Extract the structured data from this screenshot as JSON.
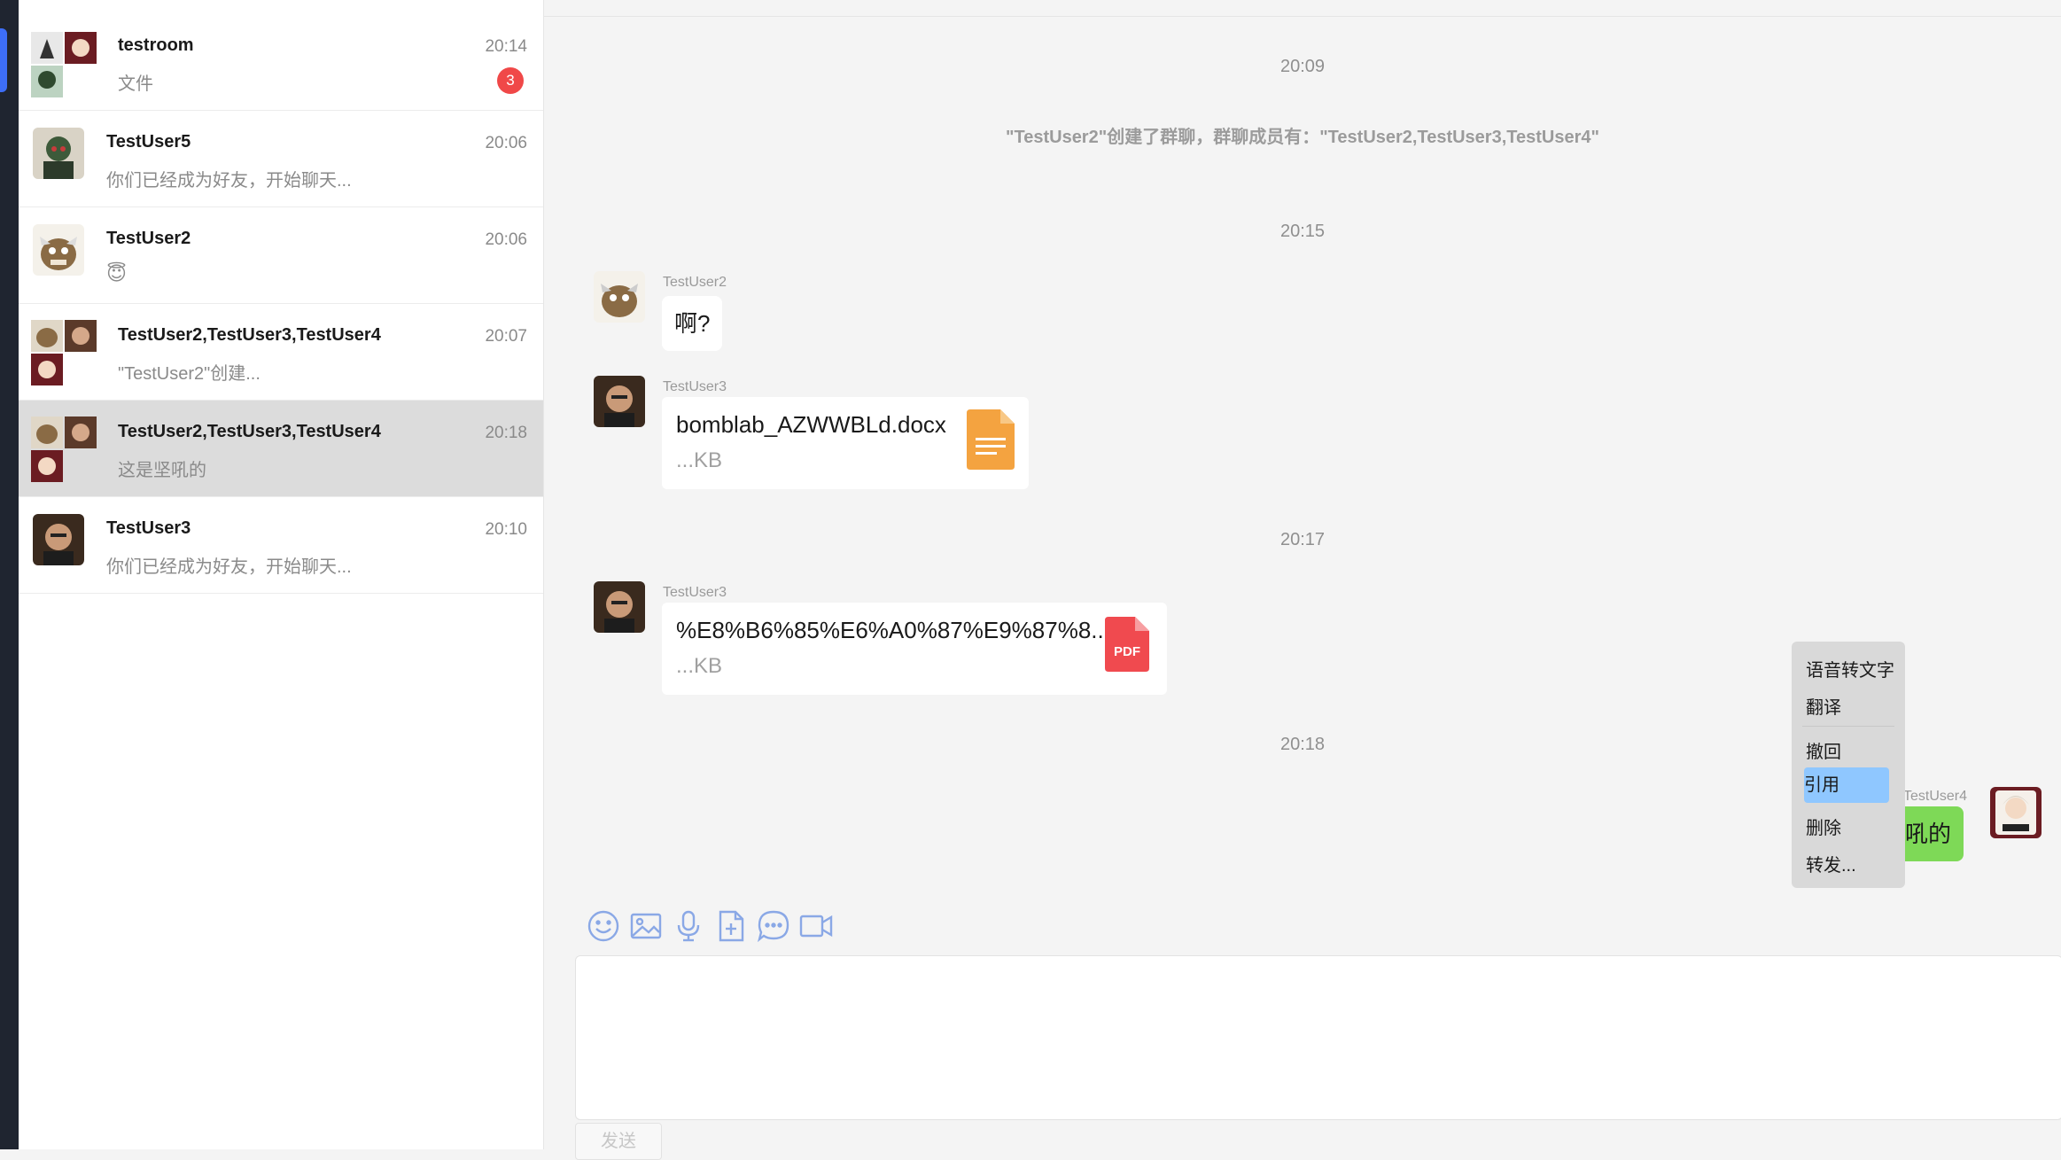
{
  "conversations": [
    {
      "name": "testroom",
      "preview": "文件",
      "time": "20:14",
      "unread": "3",
      "group": true
    },
    {
      "name": "TestUser5",
      "preview": "你们已经成为好友，开始聊天...",
      "time": "20:06"
    },
    {
      "name": "TestUser2",
      "preview": "😇",
      "time": "20:06"
    },
    {
      "name": "TestUser2,TestUser3,TestUser4",
      "preview": "\"TestUser2\"创建...",
      "time": "20:07",
      "group": true
    },
    {
      "name": "TestUser2,TestUser3,TestUser4",
      "preview": "这是坚吼的",
      "time": "20:18",
      "group": true,
      "selected": true
    },
    {
      "name": "TestUser3",
      "preview": "你们已经成为好友，开始聊天...",
      "time": "20:10"
    }
  ],
  "chat": {
    "times": [
      "20:09",
      "20:15",
      "20:17",
      "20:18"
    ],
    "system_notice": "\"TestUser2\"创建了群聊，群聊成员有：\"TestUser2,TestUser3,TestUser4\"",
    "messages": [
      {
        "sender": "TestUser2",
        "text": "啊?"
      },
      {
        "sender": "TestUser3",
        "file_name": "bomblab_AZWWBLd.docx",
        "file_size": "...KB",
        "file_type": "doc"
      },
      {
        "sender": "TestUser3",
        "file_name": "%E8%B6%85%E6%A0%87%E9%87%8...",
        "file_size": "...KB",
        "file_type": "pdf",
        "file_badge": "PDF"
      },
      {
        "sender": "TestUser4",
        "text": "吼的",
        "own": true
      }
    ]
  },
  "context_menu": {
    "items": [
      "语音转文字",
      "翻译",
      "撤回",
      "引用",
      "删除",
      "转发..."
    ],
    "highlighted": "引用"
  },
  "toolbar": {
    "icons": [
      "emoji-icon",
      "image-icon",
      "microphone-icon",
      "file-upload-icon",
      "chat-bubble-icon",
      "video-icon"
    ]
  },
  "composer": {
    "send_label": "发送"
  },
  "colors": {
    "accent": "#3d6ef7",
    "badge": "#f04848",
    "own_bubble": "#7ed957",
    "menu_highlight": "#8fc7ff",
    "toolbar_icon": "#8aa8e6"
  }
}
